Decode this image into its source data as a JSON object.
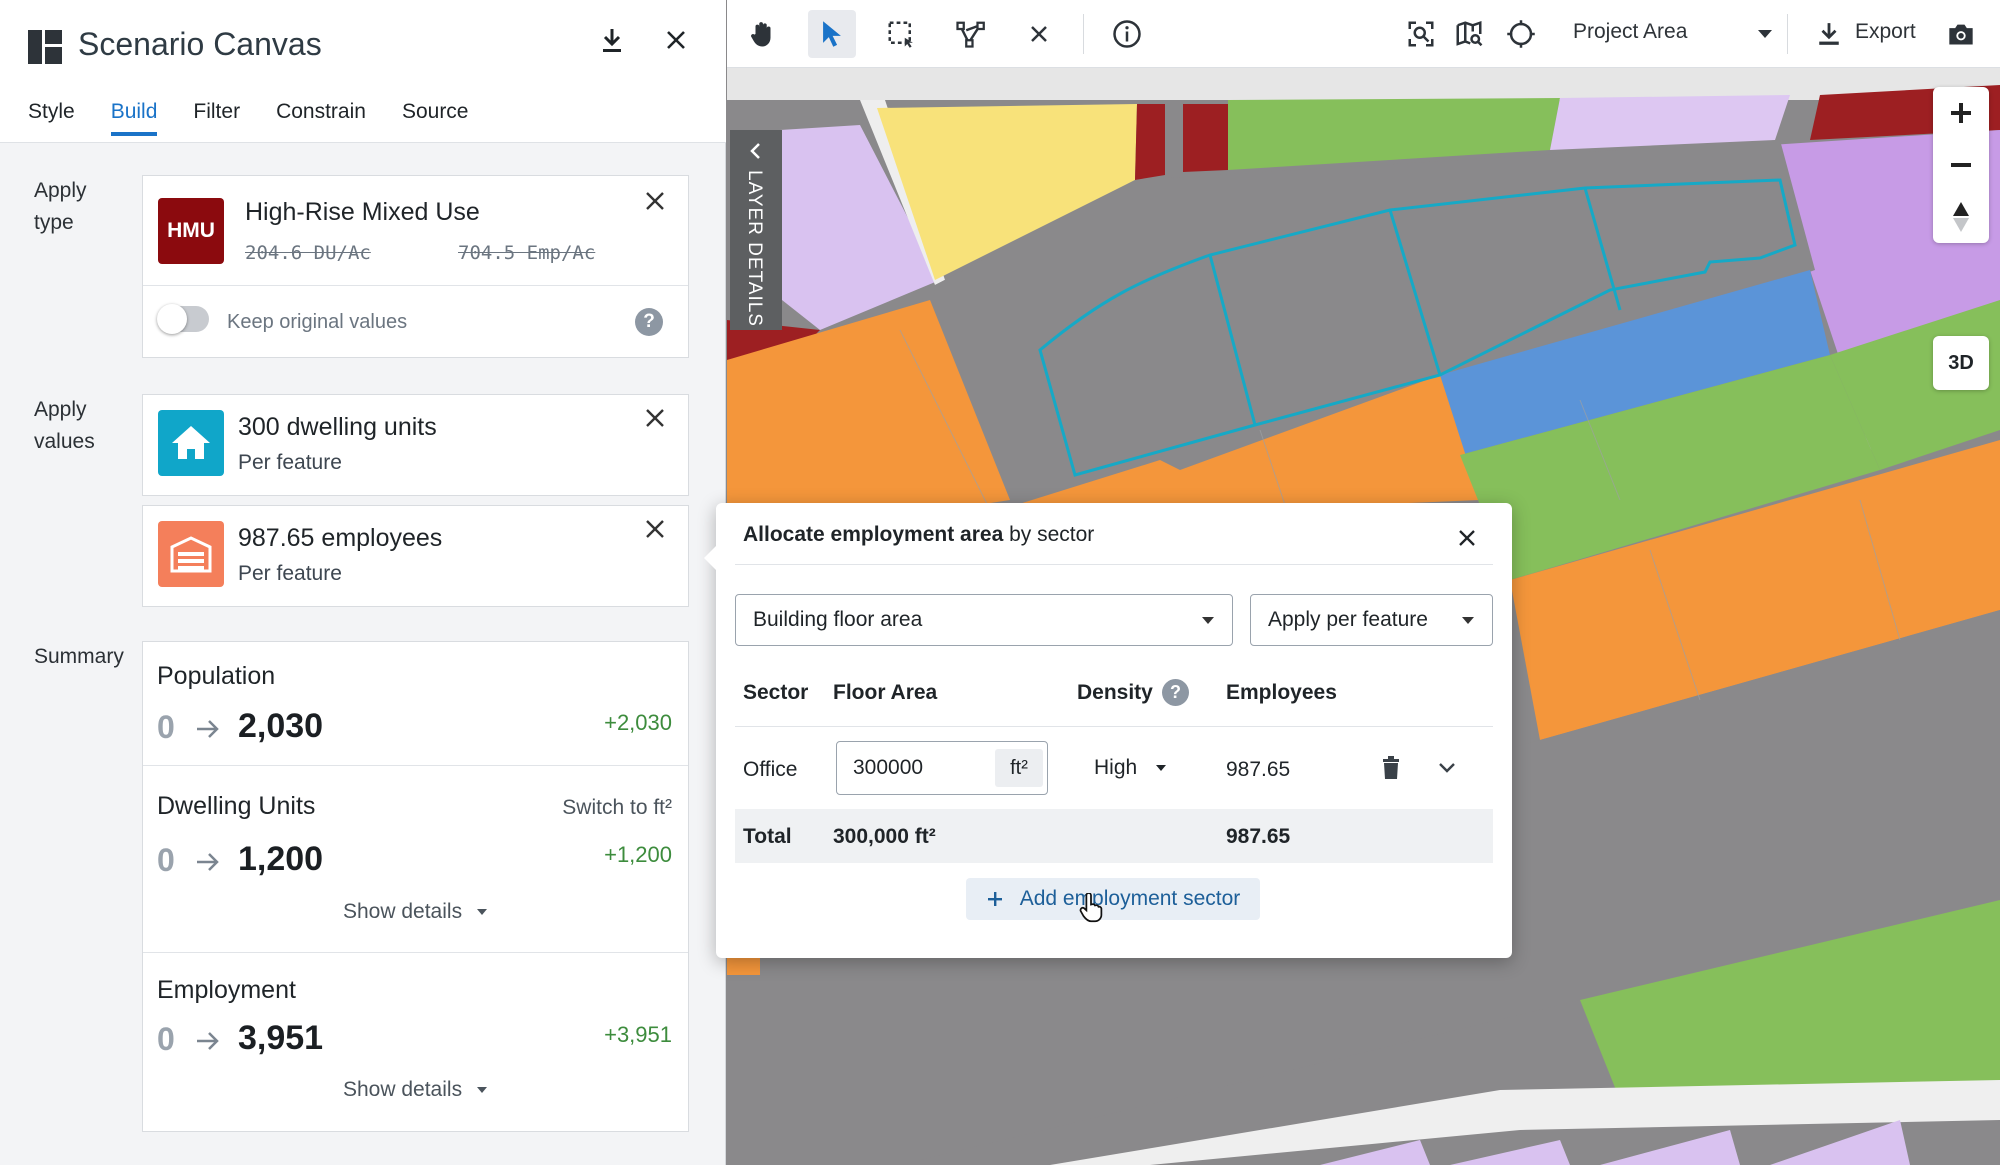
{
  "panel": {
    "title": "Scenario Canvas",
    "tabs": [
      "Style",
      "Build",
      "Filter",
      "Constrain",
      "Source"
    ],
    "active_tab": "Build",
    "apply_type": {
      "label_line1": "Apply",
      "label_line2": "type",
      "badge": "HMU",
      "badge_color": "#8b0a0e",
      "name": "High-Rise Mixed Use",
      "du": "204.6 DU/Ac",
      "emp": "704.5 Emp/Ac",
      "keep_label": "Keep original values"
    },
    "apply_values": {
      "label_line1": "Apply",
      "label_line2": "values",
      "items": [
        {
          "title": "300 dwelling units",
          "sub": "Per feature",
          "color": "#10a6c9"
        },
        {
          "title": "987.65 employees",
          "sub": "Per feature",
          "color": "#f47f5b"
        }
      ]
    },
    "summary": {
      "label": "Summary",
      "population": {
        "title": "Population",
        "from": "0",
        "to": "2,030",
        "delta": "+2,030"
      },
      "dwelling": {
        "title": "Dwelling Units",
        "switch": "Switch to ft²",
        "from": "0",
        "to": "1,200",
        "delta": "+1,200",
        "details": "Show details"
      },
      "employment": {
        "title": "Employment",
        "from": "0",
        "to": "3,951",
        "delta": "+3,951",
        "details": "Show details"
      }
    }
  },
  "toolbar": {
    "area_label": "Project Area",
    "export_label": "Export"
  },
  "map": {
    "layer_details": "LAYER DETAILS",
    "mode_3d": "3D"
  },
  "popup": {
    "title_bold": "Allocate employment area",
    "title_rest": " by sector",
    "basis": "Building floor area",
    "apply_mode": "Apply per feature",
    "headers": {
      "sector": "Sector",
      "floor_area": "Floor Area",
      "density": "Density",
      "employees": "Employees"
    },
    "row": {
      "sector": "Office",
      "floor_area": "300000",
      "unit": "ft²",
      "density": "High",
      "employees": "987.65"
    },
    "total": {
      "label": "Total",
      "floor_area": "300,000 ft²",
      "employees": "987.65"
    },
    "add_label": "Add employment sector"
  }
}
